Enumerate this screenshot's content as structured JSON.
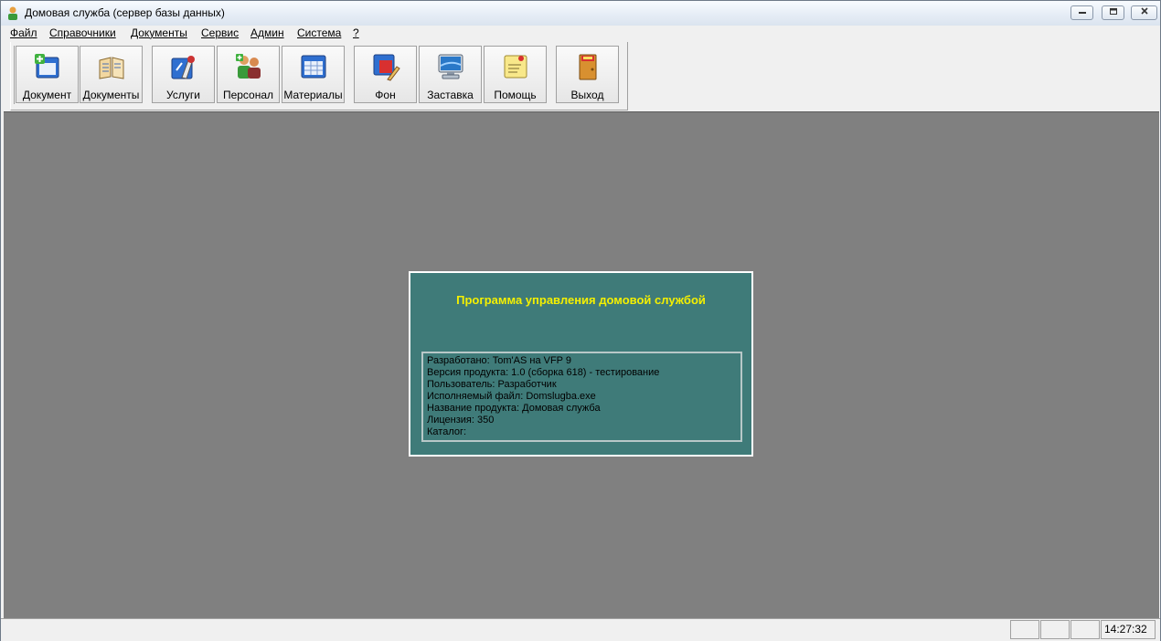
{
  "window": {
    "title": "Домовая служба (сервер базы данных)",
    "controls": {
      "minimize": "▭",
      "maximize": "▢",
      "close": "✕"
    }
  },
  "menu": {
    "items": [
      {
        "label": "Файл"
      },
      {
        "label": "Справочники"
      },
      {
        "label": "Документы"
      },
      {
        "label": "Сервис"
      },
      {
        "label": "Админ"
      },
      {
        "label": "Система"
      },
      {
        "label": "?"
      }
    ]
  },
  "toolbar": {
    "buttons": [
      {
        "label": "Документ",
        "icon": "new-document-icon"
      },
      {
        "label": "Документы",
        "icon": "documents-book-icon"
      },
      {
        "label": "Услуги",
        "icon": "services-tools-icon"
      },
      {
        "label": "Персонал",
        "icon": "personnel-people-icon"
      },
      {
        "label": "Материалы",
        "icon": "materials-table-icon"
      },
      {
        "label": "Фон",
        "icon": "background-paint-icon"
      },
      {
        "label": "Заставка",
        "icon": "screensaver-monitor-icon"
      },
      {
        "label": "Помощь",
        "icon": "help-note-icon"
      },
      {
        "label": "Выход",
        "icon": "exit-door-icon"
      }
    ]
  },
  "splash": {
    "title": "Программа управления домовой службой",
    "info": [
      "Разработано: Tom'AS на VFP 9",
      "Версия продукта: 1.0 (сборка 618) - тестирование",
      "Пользователь: Разработчик",
      "Исполняемый файл: Domslugba.exe",
      "Название продукта: Домовая служба",
      "Лицензия: 350",
      "Каталог:"
    ]
  },
  "statusbar": {
    "clock": "14:27:32"
  },
  "colors": {
    "workarea": "#808080",
    "splash_bg": "#3f7b79",
    "splash_title": "#f5f000"
  }
}
